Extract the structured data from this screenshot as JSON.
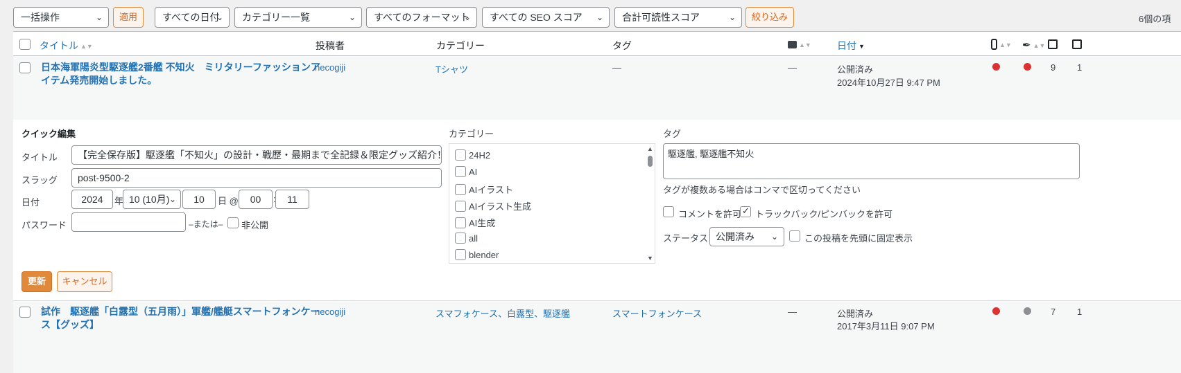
{
  "filters": {
    "bulk": "一括操作",
    "apply": "適用",
    "dates": "すべての日付",
    "categories": "カテゴリー一覧",
    "formats": "すべてのフォーマット",
    "seo": "すべての SEO スコア",
    "readability": "合計可読性スコア",
    "filter_btn": "絞り込み",
    "items_count": "6個の項"
  },
  "columns": {
    "title": "タイトル",
    "author": "投稿者",
    "category": "カテゴリー",
    "tags": "タグ",
    "date": "日付"
  },
  "rows": [
    {
      "title_line1": "日本海軍陽炎型駆逐艦2番艦 不知火　ミリタリーファッションア",
      "title_line2": "イテム発売開始しました。",
      "author": "necogiji",
      "categories": "Tシャツ",
      "tags": "—",
      "comments": "—",
      "status": "公開済み",
      "date": "2024年10月27日 9:47 PM",
      "seo_color": "#dc3232",
      "read_color": "#dc3232",
      "links_out": "9",
      "links_in": "1"
    },
    {
      "title_line1": "試作　駆逐艦「白露型（五月雨）」軍艦/艦艇スマートフォンケー",
      "title_line2": "ス【グッズ】",
      "author": "necogiji",
      "categories": "スマフォケース、白露型、駆逐艦",
      "tags": "スマートフォンケース",
      "comments": "—",
      "status": "公開済み",
      "date": "2017年3月11日 9:07 PM",
      "seo_color": "#dc3232",
      "read_color": "#8c8f94",
      "links_out": "7",
      "links_in": "1"
    }
  ],
  "quick_edit": {
    "heading": "クイック編集",
    "title_label": "タイトル",
    "title_value": "【完全保存版】駆逐艦「不知火」の設計・戦歴・最期まで全記録＆限定グッズ紹介！",
    "slug_label": "スラッグ",
    "slug_value": "post-9500-2",
    "date_label": "日付",
    "year": "2024",
    "year_suffix": "年",
    "month": "10 (10月)",
    "day": "10",
    "day_suffix": "日 @",
    "hour": "00",
    "colon": ":",
    "minute": "11",
    "password_label": "パスワード",
    "password_value": "",
    "or_text": "–または–",
    "private_label": "非公開",
    "category_label": "カテゴリー",
    "category_items": [
      "24H2",
      "AI",
      "AIイラスト",
      "AIイラスト生成",
      "AI生成",
      "all",
      "blender"
    ],
    "tags_label": "タグ",
    "tags_value": "駆逐艦, 駆逐艦不知火",
    "tags_hint": "タグが複数ある場合はコンマで区切ってください",
    "allow_comments": "コメントを許可",
    "allow_pings": "トラックバック/ピンバックを許可",
    "status_label": "ステータス",
    "status_value": "公開済み",
    "sticky_label": "この投稿を先頭に固定表示",
    "update_btn": "更新",
    "cancel_btn": "キャンセル"
  }
}
